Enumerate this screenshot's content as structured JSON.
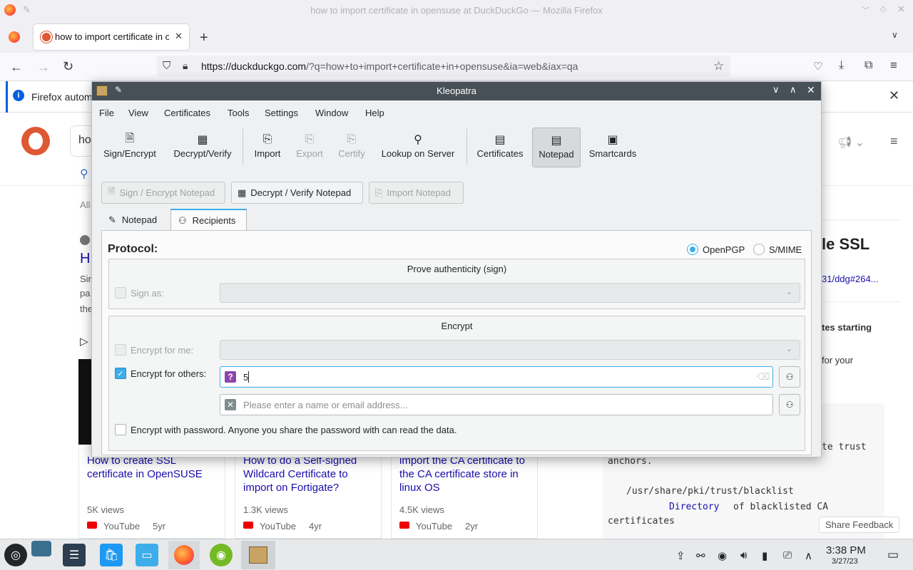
{
  "firefox": {
    "window_title": "how to import certificate in opensuse at DuckDuckGo — Mozilla Firefox",
    "tab_title": "how to import certificate in opensuse at DuckDuckGo",
    "url_domain": "https://duckduckgo.com",
    "url_rest": "/?q=how+to+import+certificate+in+opensuse&ia=web&iax=qa",
    "notification_text": "Firefox autom"
  },
  "page": {
    "search_partial": "ho",
    "filter_partial": "All",
    "result_title_partial": "H",
    "snippet_lines": [
      "Sin",
      "pa",
      "the"
    ],
    "side_title_partial": "le SSL",
    "side_link_partial": "31/ddg#264...",
    "side_bold_partial": "tes starting",
    "side_text_partial": "for your",
    "videos": [
      {
        "title": "How to create SSL certificate in OpenSUSE",
        "views": "5K views",
        "source": "YouTube",
        "age": "5yr"
      },
      {
        "title": "How to do a Self-signed Wildcard Certificate to import on Fortigate?",
        "views": "1.3K views",
        "source": "YouTube",
        "age": "4yr"
      },
      {
        "title": "import the CA certificate to the CA certificate store in linux OS",
        "views": "4.5K views",
        "source": "YouTube",
        "age": "2yr"
      }
    ],
    "code_lines": [
      "te trust",
      "anchors.",
      "/usr/share/pki/trust/blacklist",
      "Directory",
      "of blacklisted CA",
      "certificates"
    ],
    "share_feedback": "Share Feedback"
  },
  "kleopatra": {
    "title": "Kleopatra",
    "menu": [
      "File",
      "View",
      "Certificates",
      "Tools",
      "Settings",
      "Window",
      "Help"
    ],
    "toolbar": {
      "sign_encrypt": "Sign/Encrypt",
      "decrypt_verify": "Decrypt/Verify",
      "import": "Import",
      "export": "Export",
      "certify": "Certify",
      "lookup": "Lookup on Server",
      "certificates": "Certificates",
      "notepad": "Notepad",
      "smartcards": "Smartcards"
    },
    "notepad_buttons": {
      "sign_encrypt": "Sign / Encrypt Notepad",
      "decrypt_verify": "Decrypt / Verify Notepad",
      "import": "Import Notepad"
    },
    "tabs": {
      "notepad": "Notepad",
      "recipients": "Recipients"
    },
    "protocol_label": "Protocol:",
    "protocol_options": {
      "openpgp": "OpenPGP",
      "smime": "S/MIME"
    },
    "prove_group": {
      "title": "Prove authenticity (sign)",
      "sign_as": "Sign as:"
    },
    "encrypt_group": {
      "title": "Encrypt",
      "encrypt_for_me": "Encrypt for me:",
      "encrypt_for_others": "Encrypt for others:",
      "recipient_value": "5",
      "recipient_placeholder": "Please enter a name or email address...",
      "password_label": "Encrypt with password. Anyone you share the password with can read the data."
    }
  },
  "taskbar": {
    "time": "3:38 PM",
    "date": "3/27/23"
  }
}
